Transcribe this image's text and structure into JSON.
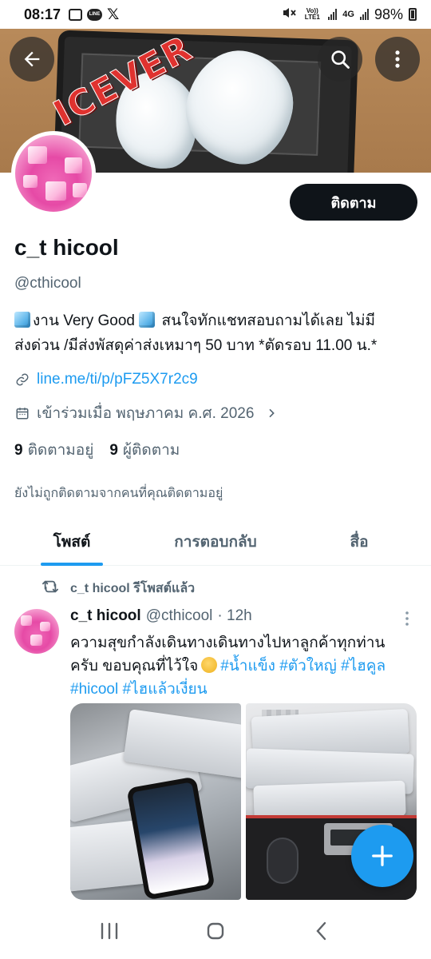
{
  "status_bar": {
    "time": "08:17",
    "volte": "Vo)) LTE1",
    "network": "4G",
    "battery": "98%"
  },
  "banner": {
    "brand_text": "ICEVER"
  },
  "profile": {
    "follow_label": "ติดตาม",
    "display_name": "c_t hicool",
    "handle": "@cthicool",
    "bio_line1": "งาน Very Good ",
    "bio_line1b": " สนใจทักแชทสอบถามได้เลย ไม่มี",
    "bio_line2": "ส่งด่วน /มีส่งพัสดุค่าส่งเหมาๆ 50 บาท *ตัดรอบ 11.00 น.*",
    "link": "line.me/ti/p/pFZ5X7r2c9",
    "joined": "เข้าร่วมเมื่อ พฤษภาคม ค.ศ. 2026",
    "following_count": "9",
    "following_label": "ติดตามอยู่",
    "followers_count": "9",
    "followers_label": "ผู้ติดตาม",
    "not_followed_note": "ยังไม่ถูกติดตามจากคนที่คุณติดตามอยู่"
  },
  "tabs": [
    {
      "label": "โพสต์",
      "active": true
    },
    {
      "label": "การตอบกลับ",
      "active": false
    },
    {
      "label": "สื่อ",
      "active": false
    }
  ],
  "post": {
    "repost_label": "c_t hicool รีโพสต์แล้ว",
    "author_name": "c_t hicool",
    "author_handle": "@cthicool",
    "time": "· 12h",
    "text_line1": "ความสุขกำลังเดินทางเดินทางไปหาลูกค้าทุกท่าน",
    "text_line2_plain": "ครับ ขอบคุณที่ไว้ใจ",
    "hashtags_line2": "#น้ำแข็ง #ตัวใหญ่ #ไฮคูล",
    "hashtags_line3": "#hicool #ไฮแล้วเงี่ยน"
  },
  "colors": {
    "accent": "#1d9bf0",
    "text_primary": "#0f1419",
    "text_secondary": "#536471",
    "follow_button_bg": "#0f1419"
  },
  "icons": {
    "back": "arrow-left-icon",
    "search": "search-icon",
    "more": "more-vertical-icon",
    "link": "link-icon",
    "calendar": "calendar-icon",
    "chevron": "chevron-right-icon",
    "repost": "repost-icon",
    "compose": "plus-icon",
    "nav_recent": "recent-apps-icon",
    "nav_home": "home-icon",
    "nav_back": "nav-back-icon"
  }
}
